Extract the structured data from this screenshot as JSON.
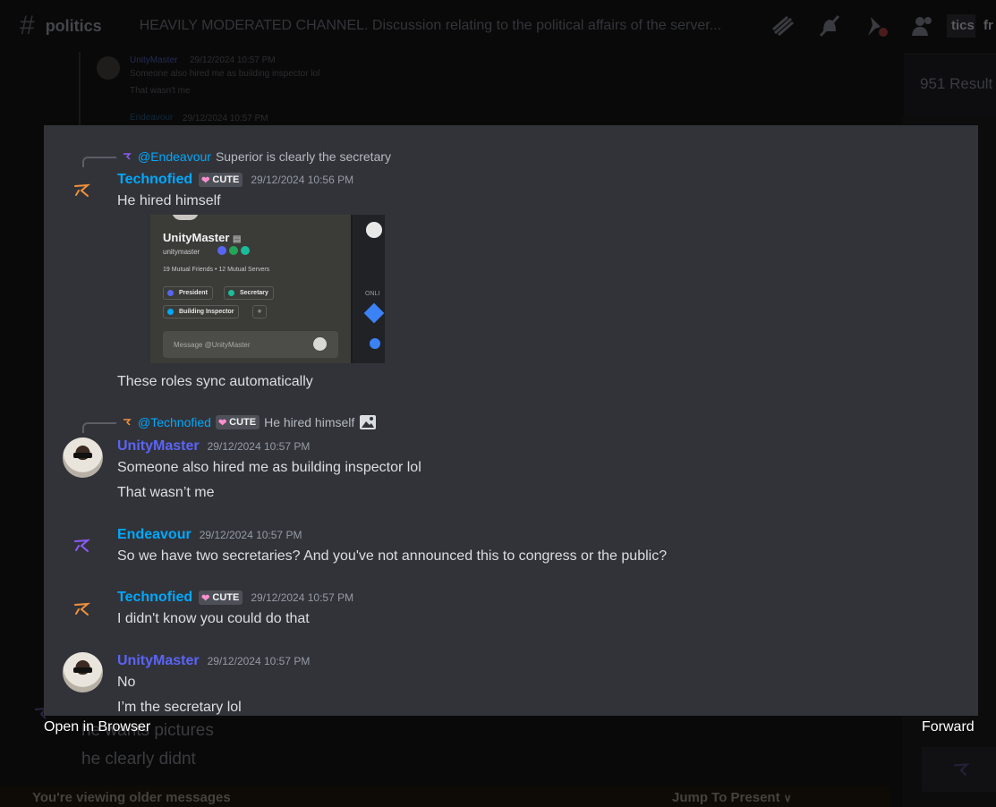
{
  "background": {
    "channel_name": "politics",
    "topic": "HEAVILY MODERATED CHANNEL. Discussion relating to the political affairs of the server...",
    "search_fragment": "tics",
    "search_fragment_2": "fr",
    "results_text": "951 Result",
    "under_text_1": "he wants pictures",
    "under_text_2": "he clearly didnt",
    "older_messages_notice": "You're viewing older messages",
    "jump_to_present": "Jump To Present",
    "quote_name": "UnityMaster",
    "quote_time": "29/12/2024 10:57 PM",
    "quote_line_1": "Someone also hired me as building inspector lol",
    "quote_line_2": "That wasn't me",
    "quote_name_2": "Endeavour",
    "quote_time_2": "29/12/2024 10:57 PM"
  },
  "viewer": {
    "open_in_browser": "Open in Browser",
    "forward": "Forward",
    "messages": [
      {
        "reply_to": "@Endeavour",
        "reply_text": "Superior is clearly the secretary",
        "author": "Technofied",
        "tag": "CUTE",
        "timestamp": "29/12/2024 10:56 PM",
        "lines": [
          "He hired himself",
          "These roles sync automatically"
        ]
      },
      {
        "reply_to": "@Technofied",
        "reply_tag": "CUTE",
        "reply_text": "He hired himself",
        "author": "UnityMaster",
        "timestamp": "29/12/2024 10:57 PM",
        "lines": [
          "Someone also hired me as building inspector lol",
          "That wasn’t me"
        ]
      },
      {
        "author": "Endeavour",
        "timestamp": "29/12/2024 10:57 PM",
        "lines": [
          "So we have two secretaries? And you've not announced this to congress or the public?"
        ]
      },
      {
        "author": "Technofied",
        "tag": "CUTE",
        "timestamp": "29/12/2024 10:57 PM",
        "lines": [
          "I didn't know you could do that"
        ]
      },
      {
        "author": "UnityMaster",
        "timestamp": "29/12/2024 10:57 PM",
        "lines": [
          "No",
          "I’m the secretary lol"
        ]
      }
    ],
    "embed": {
      "name": "UnityMaster",
      "handle": "unitymaster",
      "mutuals": "19 Mutual Friends  •  12 Mutual Servers",
      "roles": [
        "President",
        "Secretary",
        "Building Inspector"
      ],
      "plus": "+",
      "input_placeholder": "Message @UnityMaster",
      "side_label": "ONLI"
    }
  },
  "colors": {
    "viewer_bg": "#323339",
    "link_blue": "#00a8fc",
    "unity_purple": "#5b64f5",
    "technofied_icon": "#f0923a",
    "endeavour_icon": "#8b5cf6"
  }
}
